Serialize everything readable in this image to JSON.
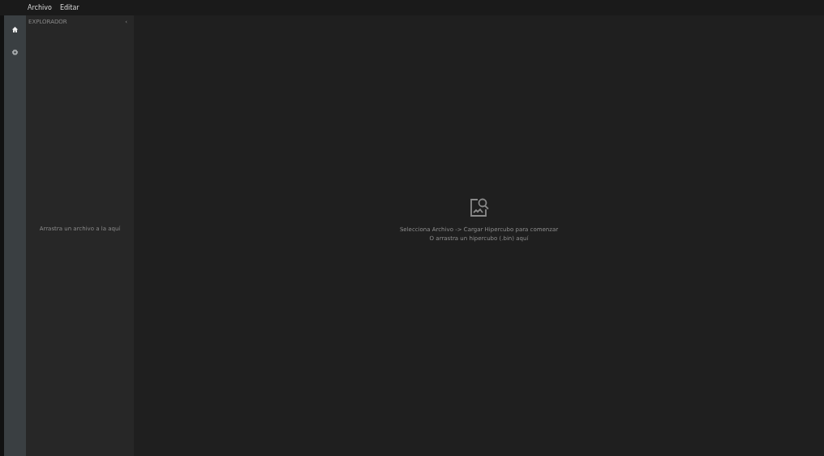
{
  "menu_bar": {
    "items": [
      "Archivo",
      "Editar"
    ]
  },
  "activity_bar": {
    "items": [
      {
        "kind": "home",
        "selected": true
      },
      {
        "kind": "settings",
        "selected": false
      }
    ]
  },
  "explorer": {
    "title": "EXPLORADOR",
    "collapse": "‹",
    "empty_text": "Arrastra un archivo a la aquí"
  },
  "main": {
    "lines": [
      "Selecciona Archivo -> Cargar Hipercubo para comenzar",
      "O arrastra un hipercubo (.bin) aquí"
    ]
  }
}
